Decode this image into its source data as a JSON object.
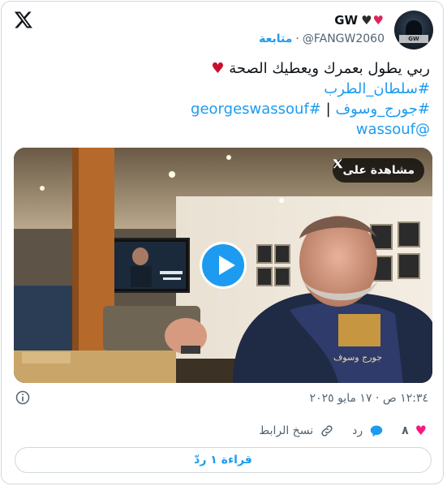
{
  "header": {
    "display_name": "GW",
    "handle": "@FANGW2060",
    "follow_label": "متابعة",
    "separator": "·"
  },
  "tweet": {
    "line1_text": "ربي يطول بعمرك ويعطيك الصحة",
    "line2_hashtag": "#سلطان_الطرب",
    "line3_hashtag_en": "#georgeswassouf",
    "line3_separator": "|",
    "line3_hashtag_ar": "#جورج_وسوف",
    "line4_mention": "@wassouf"
  },
  "media": {
    "watch_label": "مشاهدة على",
    "watch_icon": "x-logo-icon",
    "towel_text": "جورج وسوف",
    "avatar_tag": "GW"
  },
  "meta": {
    "timestamp": "١٢:٣٤ ص · ١٧ مايو ٢٠٢٥"
  },
  "actions": {
    "like_count": "٨",
    "reply_label": "رد",
    "copy_label": "نسخ الرابط"
  },
  "read_replies_label": "قراءة ١ ردّ",
  "colors": {
    "accent": "#1d9bf0",
    "like": "#f91880",
    "border": "#cfd9de",
    "muted": "#536471"
  }
}
